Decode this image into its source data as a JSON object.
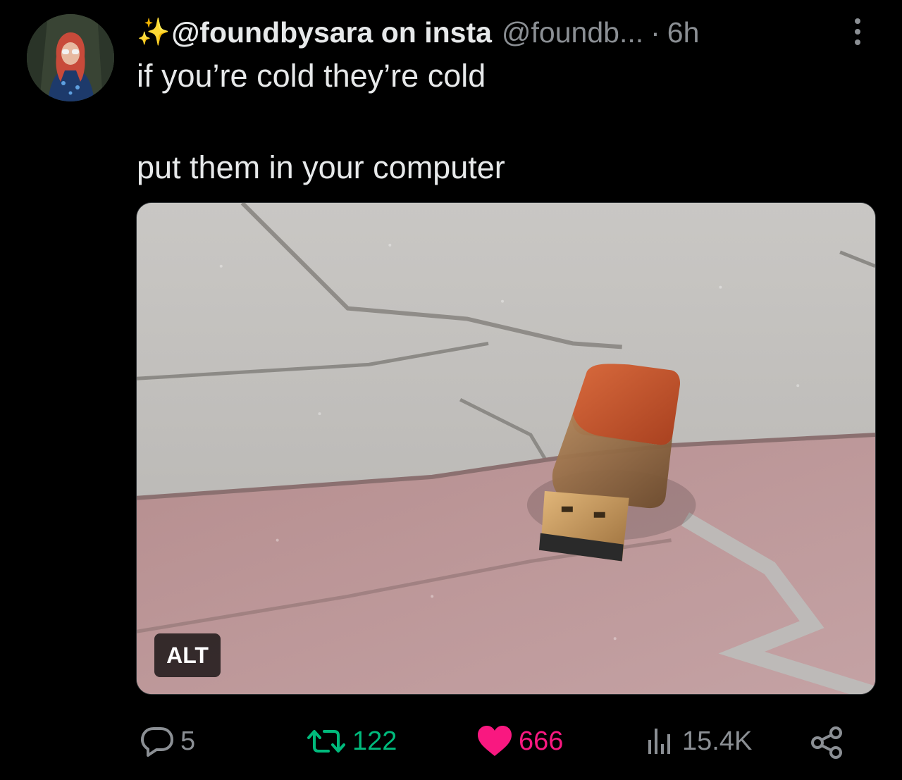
{
  "author": {
    "display_name_prefix": "✨",
    "display_name": "@foundbysara on insta",
    "handle": "@foundb...",
    "separator": "·",
    "time": "6h"
  },
  "tweet": {
    "line1": "if you’re cold they’re cold",
    "line2": "put them in your computer"
  },
  "media": {
    "alt_label": "ALT"
  },
  "actions": {
    "reply_count": "5",
    "retweet_count": "122",
    "like_count": "666",
    "views_count": "15.4K"
  },
  "colors": {
    "background": "#000000",
    "text": "#e7e9ea",
    "muted": "#8b8f94",
    "retweet": "#00ba7c",
    "like": "#f91880",
    "sparkle": "#f5c518"
  },
  "icons": [
    "more-vertical-icon",
    "reply-icon",
    "retweet-icon",
    "heart-icon",
    "views-icon",
    "share-icon"
  ]
}
